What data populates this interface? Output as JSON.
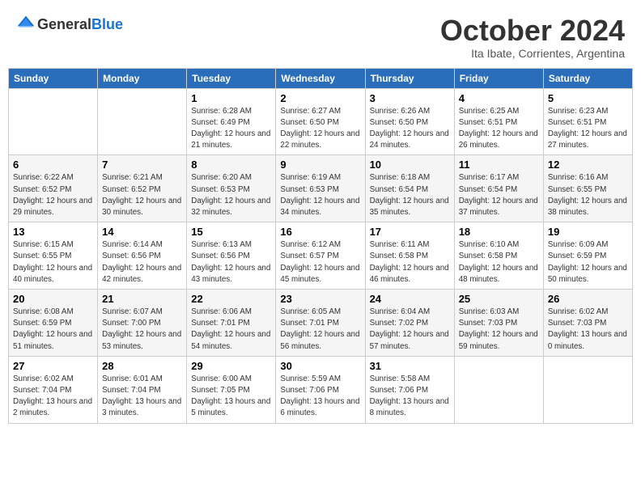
{
  "header": {
    "logo_general": "General",
    "logo_blue": "Blue",
    "month": "October 2024",
    "location": "Ita Ibate, Corrientes, Argentina"
  },
  "days_of_week": [
    "Sunday",
    "Monday",
    "Tuesday",
    "Wednesday",
    "Thursday",
    "Friday",
    "Saturday"
  ],
  "weeks": [
    [
      {
        "day": "",
        "sunrise": "",
        "sunset": "",
        "daylight": ""
      },
      {
        "day": "",
        "sunrise": "",
        "sunset": "",
        "daylight": ""
      },
      {
        "day": "1",
        "sunrise": "Sunrise: 6:28 AM",
        "sunset": "Sunset: 6:49 PM",
        "daylight": "Daylight: 12 hours and 21 minutes."
      },
      {
        "day": "2",
        "sunrise": "Sunrise: 6:27 AM",
        "sunset": "Sunset: 6:50 PM",
        "daylight": "Daylight: 12 hours and 22 minutes."
      },
      {
        "day": "3",
        "sunrise": "Sunrise: 6:26 AM",
        "sunset": "Sunset: 6:50 PM",
        "daylight": "Daylight: 12 hours and 24 minutes."
      },
      {
        "day": "4",
        "sunrise": "Sunrise: 6:25 AM",
        "sunset": "Sunset: 6:51 PM",
        "daylight": "Daylight: 12 hours and 26 minutes."
      },
      {
        "day": "5",
        "sunrise": "Sunrise: 6:23 AM",
        "sunset": "Sunset: 6:51 PM",
        "daylight": "Daylight: 12 hours and 27 minutes."
      }
    ],
    [
      {
        "day": "6",
        "sunrise": "Sunrise: 6:22 AM",
        "sunset": "Sunset: 6:52 PM",
        "daylight": "Daylight: 12 hours and 29 minutes."
      },
      {
        "day": "7",
        "sunrise": "Sunrise: 6:21 AM",
        "sunset": "Sunset: 6:52 PM",
        "daylight": "Daylight: 12 hours and 30 minutes."
      },
      {
        "day": "8",
        "sunrise": "Sunrise: 6:20 AM",
        "sunset": "Sunset: 6:53 PM",
        "daylight": "Daylight: 12 hours and 32 minutes."
      },
      {
        "day": "9",
        "sunrise": "Sunrise: 6:19 AM",
        "sunset": "Sunset: 6:53 PM",
        "daylight": "Daylight: 12 hours and 34 minutes."
      },
      {
        "day": "10",
        "sunrise": "Sunrise: 6:18 AM",
        "sunset": "Sunset: 6:54 PM",
        "daylight": "Daylight: 12 hours and 35 minutes."
      },
      {
        "day": "11",
        "sunrise": "Sunrise: 6:17 AM",
        "sunset": "Sunset: 6:54 PM",
        "daylight": "Daylight: 12 hours and 37 minutes."
      },
      {
        "day": "12",
        "sunrise": "Sunrise: 6:16 AM",
        "sunset": "Sunset: 6:55 PM",
        "daylight": "Daylight: 12 hours and 38 minutes."
      }
    ],
    [
      {
        "day": "13",
        "sunrise": "Sunrise: 6:15 AM",
        "sunset": "Sunset: 6:55 PM",
        "daylight": "Daylight: 12 hours and 40 minutes."
      },
      {
        "day": "14",
        "sunrise": "Sunrise: 6:14 AM",
        "sunset": "Sunset: 6:56 PM",
        "daylight": "Daylight: 12 hours and 42 minutes."
      },
      {
        "day": "15",
        "sunrise": "Sunrise: 6:13 AM",
        "sunset": "Sunset: 6:56 PM",
        "daylight": "Daylight: 12 hours and 43 minutes."
      },
      {
        "day": "16",
        "sunrise": "Sunrise: 6:12 AM",
        "sunset": "Sunset: 6:57 PM",
        "daylight": "Daylight: 12 hours and 45 minutes."
      },
      {
        "day": "17",
        "sunrise": "Sunrise: 6:11 AM",
        "sunset": "Sunset: 6:58 PM",
        "daylight": "Daylight: 12 hours and 46 minutes."
      },
      {
        "day": "18",
        "sunrise": "Sunrise: 6:10 AM",
        "sunset": "Sunset: 6:58 PM",
        "daylight": "Daylight: 12 hours and 48 minutes."
      },
      {
        "day": "19",
        "sunrise": "Sunrise: 6:09 AM",
        "sunset": "Sunset: 6:59 PM",
        "daylight": "Daylight: 12 hours and 50 minutes."
      }
    ],
    [
      {
        "day": "20",
        "sunrise": "Sunrise: 6:08 AM",
        "sunset": "Sunset: 6:59 PM",
        "daylight": "Daylight: 12 hours and 51 minutes."
      },
      {
        "day": "21",
        "sunrise": "Sunrise: 6:07 AM",
        "sunset": "Sunset: 7:00 PM",
        "daylight": "Daylight: 12 hours and 53 minutes."
      },
      {
        "day": "22",
        "sunrise": "Sunrise: 6:06 AM",
        "sunset": "Sunset: 7:01 PM",
        "daylight": "Daylight: 12 hours and 54 minutes."
      },
      {
        "day": "23",
        "sunrise": "Sunrise: 6:05 AM",
        "sunset": "Sunset: 7:01 PM",
        "daylight": "Daylight: 12 hours and 56 minutes."
      },
      {
        "day": "24",
        "sunrise": "Sunrise: 6:04 AM",
        "sunset": "Sunset: 7:02 PM",
        "daylight": "Daylight: 12 hours and 57 minutes."
      },
      {
        "day": "25",
        "sunrise": "Sunrise: 6:03 AM",
        "sunset": "Sunset: 7:03 PM",
        "daylight": "Daylight: 12 hours and 59 minutes."
      },
      {
        "day": "26",
        "sunrise": "Sunrise: 6:02 AM",
        "sunset": "Sunset: 7:03 PM",
        "daylight": "Daylight: 13 hours and 0 minutes."
      }
    ],
    [
      {
        "day": "27",
        "sunrise": "Sunrise: 6:02 AM",
        "sunset": "Sunset: 7:04 PM",
        "daylight": "Daylight: 13 hours and 2 minutes."
      },
      {
        "day": "28",
        "sunrise": "Sunrise: 6:01 AM",
        "sunset": "Sunset: 7:04 PM",
        "daylight": "Daylight: 13 hours and 3 minutes."
      },
      {
        "day": "29",
        "sunrise": "Sunrise: 6:00 AM",
        "sunset": "Sunset: 7:05 PM",
        "daylight": "Daylight: 13 hours and 5 minutes."
      },
      {
        "day": "30",
        "sunrise": "Sunrise: 5:59 AM",
        "sunset": "Sunset: 7:06 PM",
        "daylight": "Daylight: 13 hours and 6 minutes."
      },
      {
        "day": "31",
        "sunrise": "Sunrise: 5:58 AM",
        "sunset": "Sunset: 7:06 PM",
        "daylight": "Daylight: 13 hours and 8 minutes."
      },
      {
        "day": "",
        "sunrise": "",
        "sunset": "",
        "daylight": ""
      },
      {
        "day": "",
        "sunrise": "",
        "sunset": "",
        "daylight": ""
      }
    ]
  ]
}
